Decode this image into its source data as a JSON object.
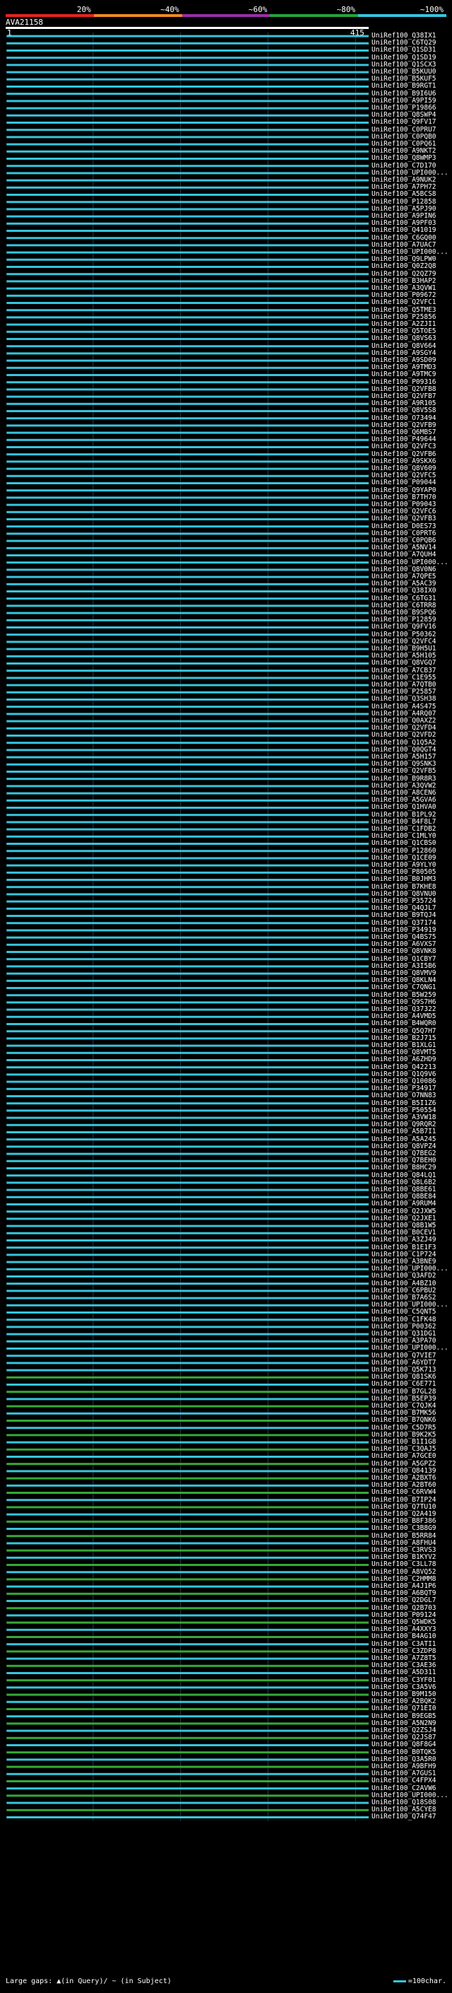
{
  "query": {
    "name": "AVA21158",
    "start_label": "1",
    "end_label": "415",
    "length": 415
  },
  "scale_bar": {
    "segments": [
      {
        "label": "20%",
        "color": "#e8231e"
      },
      {
        "label": "~40%",
        "color": "#ef8a22"
      },
      {
        "label": "~60%",
        "color": "#9a2fa8"
      },
      {
        "label": "~80%",
        "color": "#25a43a"
      },
      {
        "label": "~100%",
        "color": "#34c6dd"
      }
    ]
  },
  "legend": {
    "large_gaps": "Large gaps: ▲(in Query)/ ~ (in Subject)",
    "scale": "=100char."
  },
  "colors": {
    "cyan": "#36c5dc",
    "green": "#35a937",
    "gap": "#0a1a2a"
  },
  "chart_data": {
    "type": "alignment",
    "title": "",
    "query_length": 415,
    "hits": [
      "UniRef100_Q38IX1",
      "UniRef100_C6TQ29",
      "UniRef100_Q1SD31",
      "UniRef100_Q1SD19",
      "UniRef100_Q1SCX3",
      "UniRef100_B5KUU0",
      "UniRef100_B5KUF5",
      "UniRef100_B9RGT1",
      "UniRef100_B9I6U6",
      "UniRef100_A9PI59",
      "UniRef100_P19866",
      "UniRef100_Q8SWP4",
      "UniRef100_Q9FV17",
      "UniRef100_C0PRU7",
      "UniRef100_C0PQB0",
      "UniRef100_C0PQ61",
      "UniRef100_A9NKT2",
      "UniRef100_Q8WMP3",
      "UniRef100_C7D170",
      "UniRef100_UPI000...",
      "UniRef100_A9NUK2",
      "UniRef100_A7PH72",
      "UniRef100_A5BCS8",
      "UniRef100_P12858",
      "UniRef100_A5PJ90",
      "UniRef100_A9PIN6",
      "UniRef100_A9PF03",
      "UniRef100_Q41019",
      "UniRef100_C6GQ00",
      "UniRef100_A7UAC7",
      "UniRef100_UPI000...",
      "UniRef100_Q9LPW0",
      "UniRef100_Q0Z2Q8",
      "UniRef100_Q2QZ79",
      "UniRef100_B3HAP2",
      "UniRef100_A3QVW1",
      "UniRef100_P09672",
      "UniRef100_Q2VFC1",
      "UniRef100_Q5TME3",
      "UniRef100_P25856",
      "UniRef100_A2ZJI1",
      "UniRef100_Q5TOE5",
      "UniRef100_Q8VS63",
      "UniRef100_Q8V664",
      "UniRef100_A9SGY4",
      "UniRef100_A9SD09",
      "UniRef100_A9TMD3",
      "UniRef100_A9TMC9",
      "UniRef100_P09316",
      "UniRef100_Q2VFB8",
      "UniRef100_Q2VFB7",
      "UniRef100_A9R105",
      "UniRef100_Q8V5S8",
      "UniRef100_O73494",
      "UniRef100_Q2VFB9",
      "UniRef100_Q6MBS7",
      "UniRef100_P49644",
      "UniRef100_Q2VFC3",
      "UniRef100_Q2VFB6",
      "UniRef100_A9SKX6",
      "UniRef100_Q8V609",
      "UniRef100_Q2VFC5",
      "UniRef100_P09044",
      "UniRef100_Q9YAP0",
      "UniRef100_B7TH70",
      "UniRef100_P09043",
      "UniRef100_Q2VFC6",
      "UniRef100_Q2VFB3",
      "UniRef100_D0ES73",
      "UniRef100_C0PRT6",
      "UniRef100_C0PQB6",
      "UniRef100_A5NV14",
      "UniRef100_A7QUH4",
      "UniRef100_UPI000...",
      "UniRef100_Q8V0N6",
      "UniRef100_A7QPE5",
      "UniRef100_A5AC39",
      "UniRef100_Q38IX0",
      "UniRef100_C6TG31",
      "UniRef100_C6TRR8",
      "UniRef100_B9SPQ6",
      "UniRef100_P12859",
      "UniRef100_Q9FV16",
      "UniRef100_P50362",
      "UniRef100_Q2VFC4",
      "UniRef100_B9H5U1",
      "UniRef100_A5H105",
      "UniRef100_Q8VGQ7",
      "UniRef100_A7CB37",
      "UniRef100_C1E955",
      "UniRef100_A7QTB0",
      "UniRef100_P25857",
      "UniRef100_Q3SH38",
      "UniRef100_A4S475",
      "UniRef100_A4RQ07",
      "UniRef100_Q0AXZ2",
      "UniRef100_Q2VFD4",
      "UniRef100_Q2VFD2",
      "UniRef100_Q1Q5A2",
      "UniRef100_Q0QGT4",
      "UniRef100_A5H157",
      "UniRef100_Q9SNK3",
      "UniRef100_Q2VFB5",
      "UniRef100_B9R8R3",
      "UniRef100_A3QVW2",
      "UniRef100_A8CEN6",
      "UniRef100_A5GVA6",
      "UniRef100_Q1HVA0",
      "UniRef100_B1PL92",
      "UniRef100_B4F8L7",
      "UniRef100_C1FDB2",
      "UniRef100_C1MLY0",
      "UniRef100_Q1CBS0",
      "UniRef100_P12860",
      "UniRef100_Q1CE09",
      "UniRef100_A9YLY0",
      "UniRef100_P80505",
      "UniRef100_B0JHM3",
      "UniRef100_B7KHE8",
      "UniRef100_Q8VNU0",
      "UniRef100_P35724",
      "UniRef100_Q4QJL7",
      "UniRef100_B9TQJ4",
      "UniRef100_Q37174",
      "UniRef100_P34919",
      "UniRef100_Q4BS75",
      "UniRef100_A6VXS7",
      "UniRef100_Q8VNK8",
      "UniRef100_Q1CBY7",
      "UniRef100_A3I5B6",
      "UniRef100_Q8VMV9",
      "UniRef100_Q8KLN4",
      "UniRef100_C7QNG1",
      "UniRef100_B5W259",
      "UniRef100_Q9S7H6",
      "UniRef100_Q37322",
      "UniRef100_A4VMD5",
      "UniRef100_B4WQR0",
      "UniRef100_Q5Q7H7",
      "UniRef100_B2J715",
      "UniRef100_B1XLG1",
      "UniRef100_Q8VMT5",
      "UniRef100_A6ZHD9",
      "UniRef100_Q42213",
      "UniRef100_Q1Q9V6",
      "UniRef100_Q10086",
      "UniRef100_P34917",
      "UniRef100_O7NN83",
      "UniRef100_B5I1Z6",
      "UniRef100_P50554",
      "UniRef100_A3VW18",
      "UniRef100_Q9RQR2",
      "UniRef100_A5B7I1",
      "UniRef100_A5A245",
      "UniRef100_Q8VPZ4",
      "UniRef100_Q7BEG2",
      "UniRef100_Q7BEH0",
      "UniRef100_B8HC29",
      "UniRef100_Q84LQ1",
      "UniRef100_Q8L6B2",
      "UniRef100_Q8BE61",
      "UniRef100_Q8BE84",
      "UniRef100_A9RUM4",
      "UniRef100_Q2JXW5",
      "UniRef100_Q2JXE1",
      "UniRef100_Q8B1W5",
      "UniRef100_B0CEV1",
      "UniRef100_A3ZJ49",
      "UniRef100_B1E1F3",
      "UniRef100_C1P724",
      "UniRef100_A3BNE9",
      "UniRef100_UPI000...",
      "UniRef100_Q3AFD2",
      "UniRef100_A4BZ10",
      "UniRef100_C6PBU2",
      "UniRef100_B7A6S2",
      "UniRef100_UPI000...",
      "UniRef100_C5QNT5",
      "UniRef100_C1FK48",
      "UniRef100_P00362",
      "UniRef100_Q31DG1",
      "UniRef100_A3PA70",
      "UniRef100_UPI000...",
      "UniRef100_Q7VIE7",
      "UniRef100_A6YDT7",
      "UniRef100_Q5K713",
      "UniRef100_Q81SK6",
      "UniRef100_C6E771",
      "UniRef100_B7GL28",
      "UniRef100_B5EP39",
      "UniRef100_C7QJK4",
      "UniRef100_B7MK56",
      "UniRef100_B7QNK6",
      "UniRef100_C5D7R5",
      "UniRef100_B9K2K5",
      "UniRef100_B1I1G8",
      "UniRef100_C3QAJ5",
      "UniRef100_A7GCE0",
      "UniRef100_A5GPZ2",
      "UniRef100_Q84139",
      "UniRef100_A2BXT6",
      "UniRef100_A2BT60",
      "UniRef100_C6RVW4",
      "UniRef100_B7IP24",
      "UniRef100_Q7TU10",
      "UniRef100_Q2A419",
      "UniRef100_B8F386",
      "UniRef100_C3B8G9",
      "UniRef100_B5RR84",
      "UniRef100_A8FHU4",
      "UniRef100_C3RVS3",
      "UniRef100_B1KYV2",
      "UniRef100_C3LL78",
      "UniRef100_A8VQ52",
      "UniRef100_C2HMM8",
      "UniRef100_A4J1P6",
      "UniRef100_A6BQT9",
      "UniRef100_Q2DGL7",
      "UniRef100_Q2B703",
      "UniRef100_P09124",
      "UniRef100_Q5WDK5",
      "UniRef100_A4XXY3",
      "UniRef100_B4AG10",
      "UniRef100_C3ATI1",
      "UniRef100_C3ZDP8",
      "UniRef100_A7Z8T5",
      "UniRef100_C3AE36",
      "UniRef100_A5D311",
      "UniRef100_C3YF01",
      "UniRef100_C3A5V6",
      "UniRef100_B9M150",
      "UniRef100_A2BQK2",
      "UniRef100_Q71EI0",
      "UniRef100_B9EGB5",
      "UniRef100_A5N2N9",
      "UniRef100_Q2ZSJ4",
      "UniRef100_Q2JS87",
      "UniRef100_Q8F8G4",
      "UniRef100_B0TQK5",
      "UniRef100_Q3A5R0",
      "UniRef100_A9BFH9",
      "UniRef100_A7GUS1",
      "UniRef100_C4FPX4",
      "UniRef100_C2AVW6",
      "UniRef100_UPI000...",
      "UniRef100_Q18S08",
      "UniRef100_A5CYE8",
      "UniRef100_Q74F47"
    ],
    "ylim": [
      0,
      415
    ]
  }
}
